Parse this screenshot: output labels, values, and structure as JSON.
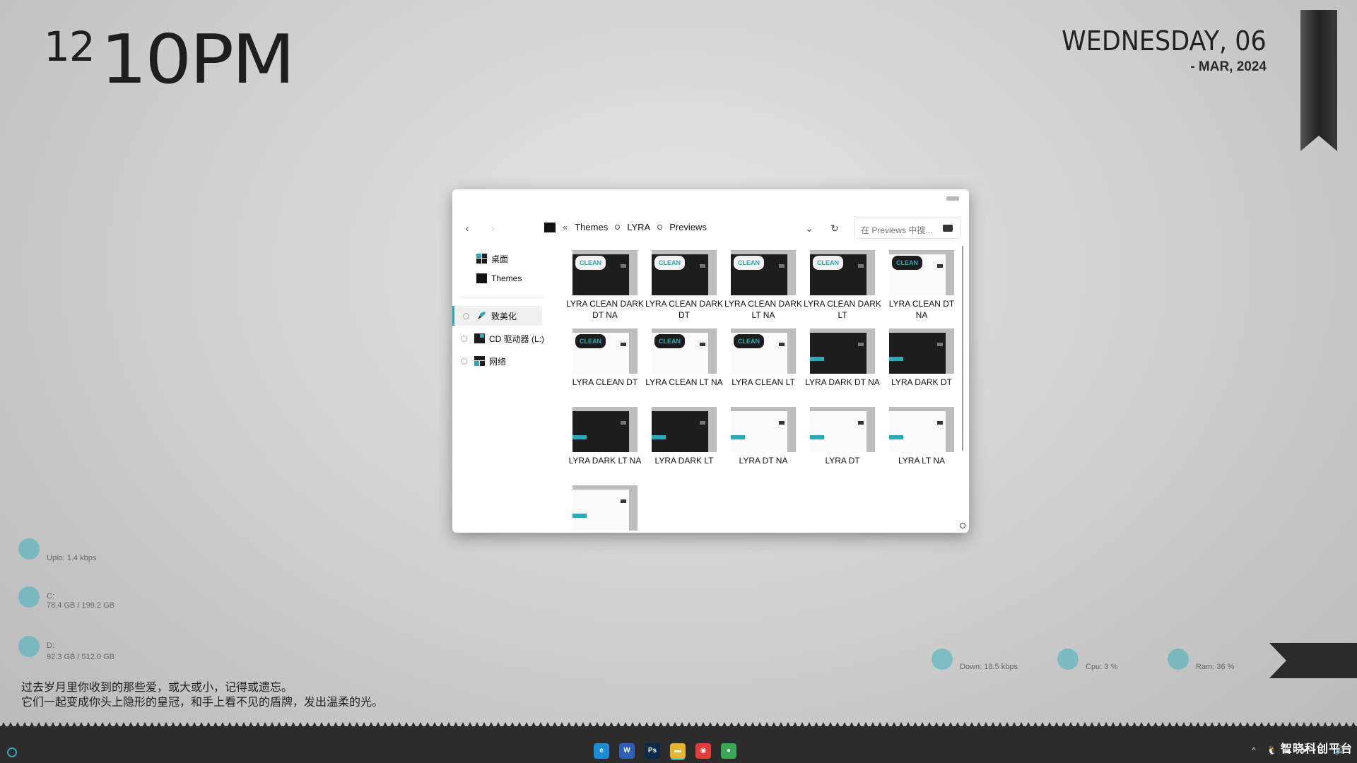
{
  "clock": {
    "hour": "12",
    "minute": "10PM"
  },
  "date": {
    "day": "WEDNESDAY, 06",
    "month": "- MAR, 2024"
  },
  "left_stats": [
    {
      "label": "Uplo: 1.4 kbps"
    },
    {
      "label": "C:",
      "value": "78.4 GB / 199.2 GB"
    },
    {
      "label": "D:",
      "value": "92.3 GB / 512.0 GB"
    }
  ],
  "quote": {
    "line1": "过去岁月里你收到的那些爱，或大或小，记得或遗忘。",
    "line2": "它们一起变成你头上隐形的皇冠，和手上看不见的盾牌，发出温柔的光。"
  },
  "bottom_stats": [
    {
      "label": "Down: 18.5 kbps"
    },
    {
      "label": "Cpu: 3 %"
    },
    {
      "label": "Ram: 36 %"
    }
  ],
  "explorer": {
    "breadcrumb": {
      "overflow": "«",
      "items": [
        "Themes",
        "LYRA",
        "Previews"
      ]
    },
    "search_placeholder": "在 Previews 中搜...",
    "nav": {
      "back": "‹",
      "forward": "›",
      "dropdown": "⌄",
      "refresh": "↻"
    },
    "sidebar": {
      "pinned": [
        {
          "label": "桌面",
          "icon": "desktop-icon"
        },
        {
          "label": "Themes",
          "icon": "folder-icon"
        }
      ],
      "drives": [
        {
          "label": "致美化",
          "icon": "brush-icon",
          "selected": true
        },
        {
          "label": "CD 驱动器 (L:)",
          "icon": "cd-drive-icon",
          "selected": false
        },
        {
          "label": "网络",
          "icon": "network-icon",
          "selected": false
        }
      ]
    },
    "files": [
      {
        "name": "LYRA CLEAN DARK DT NA",
        "style": "dark",
        "tag": "CLEAN"
      },
      {
        "name": "LYRA CLEAN DARK DT",
        "style": "dark",
        "tag": "CLEAN"
      },
      {
        "name": "LYRA CLEAN DARK LT NA",
        "style": "dark",
        "tag": "CLEAN"
      },
      {
        "name": "LYRA CLEAN DARK LT",
        "style": "dark",
        "tag": "CLEAN"
      },
      {
        "name": "LYRA CLEAN DT NA",
        "style": "light",
        "tag": "CLEAN"
      },
      {
        "name": "LYRA CLEAN DT",
        "style": "light",
        "tag": "CLEAN"
      },
      {
        "name": "LYRA CLEAN LT NA",
        "style": "light",
        "tag": "CLEAN"
      },
      {
        "name": "LYRA CLEAN LT",
        "style": "light",
        "tag": "CLEAN"
      },
      {
        "name": "LYRA DARK DT NA",
        "style": "dark",
        "tag": ""
      },
      {
        "name": "LYRA DARK DT",
        "style": "dark",
        "tag": ""
      },
      {
        "name": "LYRA DARK LT NA",
        "style": "dark",
        "tag": ""
      },
      {
        "name": "LYRA DARK LT",
        "style": "dark",
        "tag": ""
      },
      {
        "name": "LYRA DT NA",
        "style": "light",
        "tag": ""
      },
      {
        "name": "LYRA DT",
        "style": "light",
        "tag": ""
      },
      {
        "name": "LYRA LT NA",
        "style": "light",
        "tag": ""
      },
      {
        "name": "",
        "style": "light",
        "tag": ""
      }
    ]
  },
  "taskbar": {
    "apps": [
      {
        "name": "edge",
        "glyph": "e",
        "color": "#1b8dd6"
      },
      {
        "name": "word",
        "glyph": "W",
        "color": "#2b5fb8"
      },
      {
        "name": "photoshop",
        "glyph": "Ps",
        "color": "#0b2a4a"
      },
      {
        "name": "file-explorer",
        "glyph": "▬",
        "color": "#e8b530",
        "active": true
      },
      {
        "name": "netease-music",
        "glyph": "◉",
        "color": "#e23d3d"
      },
      {
        "name": "chrome",
        "glyph": "●",
        "color": "#3aa757"
      }
    ],
    "tray": [
      "^",
      "🐧",
      "☁",
      "➤",
      "▭",
      "🔊"
    ],
    "watermark": "智晓科创平台"
  },
  "colors": {
    "accent": "#2da8b8",
    "window_bg": "#ffffff",
    "taskbar": "#2c2c2c"
  }
}
